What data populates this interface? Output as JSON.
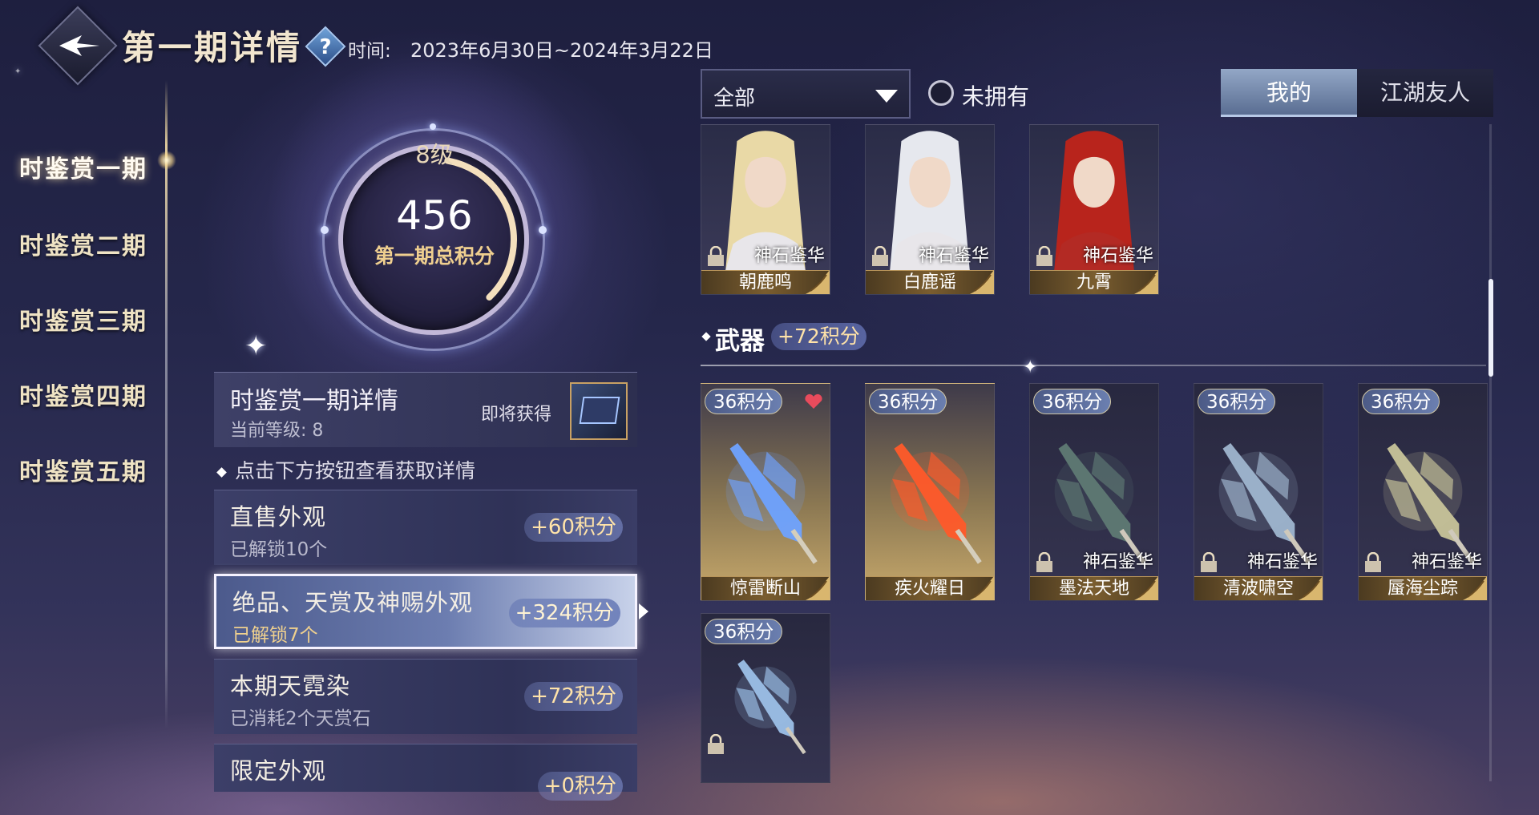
{
  "header": {
    "title": "第一期详情",
    "help_icon": "?",
    "time_label": "时间:",
    "time_range": "2023年6月30日~2024年3月22日"
  },
  "nav": {
    "items": [
      "时鉴赏一期",
      "时鉴赏二期",
      "时鉴赏三期",
      "时鉴赏四期",
      "时鉴赏五期"
    ],
    "active_index": 0
  },
  "progress": {
    "level": "8级",
    "score": "456",
    "score_label": "第一期总积分",
    "level_fill": 0.35
  },
  "detail": {
    "title": "时鉴赏一期详情",
    "current_level": "当前等级: 8",
    "upcoming": "即将获得"
  },
  "hint": "点击下方按钮查看获取详情",
  "sources": [
    {
      "name": "直售外观",
      "sub": "已解锁10个",
      "points": "+60积分"
    },
    {
      "name": "绝品、天赏及神赐外观",
      "sub": "已解锁7个",
      "points": "+324积分"
    },
    {
      "name": "本期天霓染",
      "sub": "已消耗2个天赏石",
      "points": "+72积分"
    },
    {
      "name": "限定外观",
      "sub": "",
      "points": "+0积分"
    }
  ],
  "filters": {
    "dropdown_value": "全部",
    "unowned_label": "未拥有",
    "tabs": [
      "我的",
      "江湖友人"
    ],
    "active_tab": 0
  },
  "characters": [
    {
      "name": "朝鹿鸣",
      "source": "神石鉴华",
      "hair": "#e9d9a6"
    },
    {
      "name": "白鹿谣",
      "source": "神石鉴华",
      "hair": "#e6e8ee"
    },
    {
      "name": "九霄",
      "source": "神石鉴华",
      "hair": "#b8241c"
    }
  ],
  "weapon_section": {
    "title": "武器",
    "points": "+72积分"
  },
  "weapons": [
    {
      "name": "惊雷断山",
      "points": "36积分",
      "source": "",
      "favorite": true,
      "style": "gold",
      "color": "#6fa3ff"
    },
    {
      "name": "疾火耀日",
      "points": "36积分",
      "source": "",
      "favorite": false,
      "style": "gold",
      "color": "#ff5a2a"
    },
    {
      "name": "墨法天地",
      "points": "36积分",
      "source": "神石鉴华",
      "favorite": false,
      "style": "dark",
      "color": "#5f7a74"
    },
    {
      "name": "清波啸空",
      "points": "36积分",
      "source": "神石鉴华",
      "favorite": false,
      "style": "dark",
      "color": "#9fb6cf"
    },
    {
      "name": "蜃海尘踪",
      "points": "36积分",
      "source": "神石鉴华",
      "favorite": false,
      "style": "dark",
      "color": "#c8c49a"
    },
    {
      "name": "",
      "points": "36积分",
      "source": "",
      "favorite": false,
      "style": "dark",
      "color": "#9cc0e8"
    }
  ],
  "colors": {
    "gold_text": "#efcf8f",
    "points_text": "#ffe3a9",
    "heart": "#e84b5c"
  }
}
